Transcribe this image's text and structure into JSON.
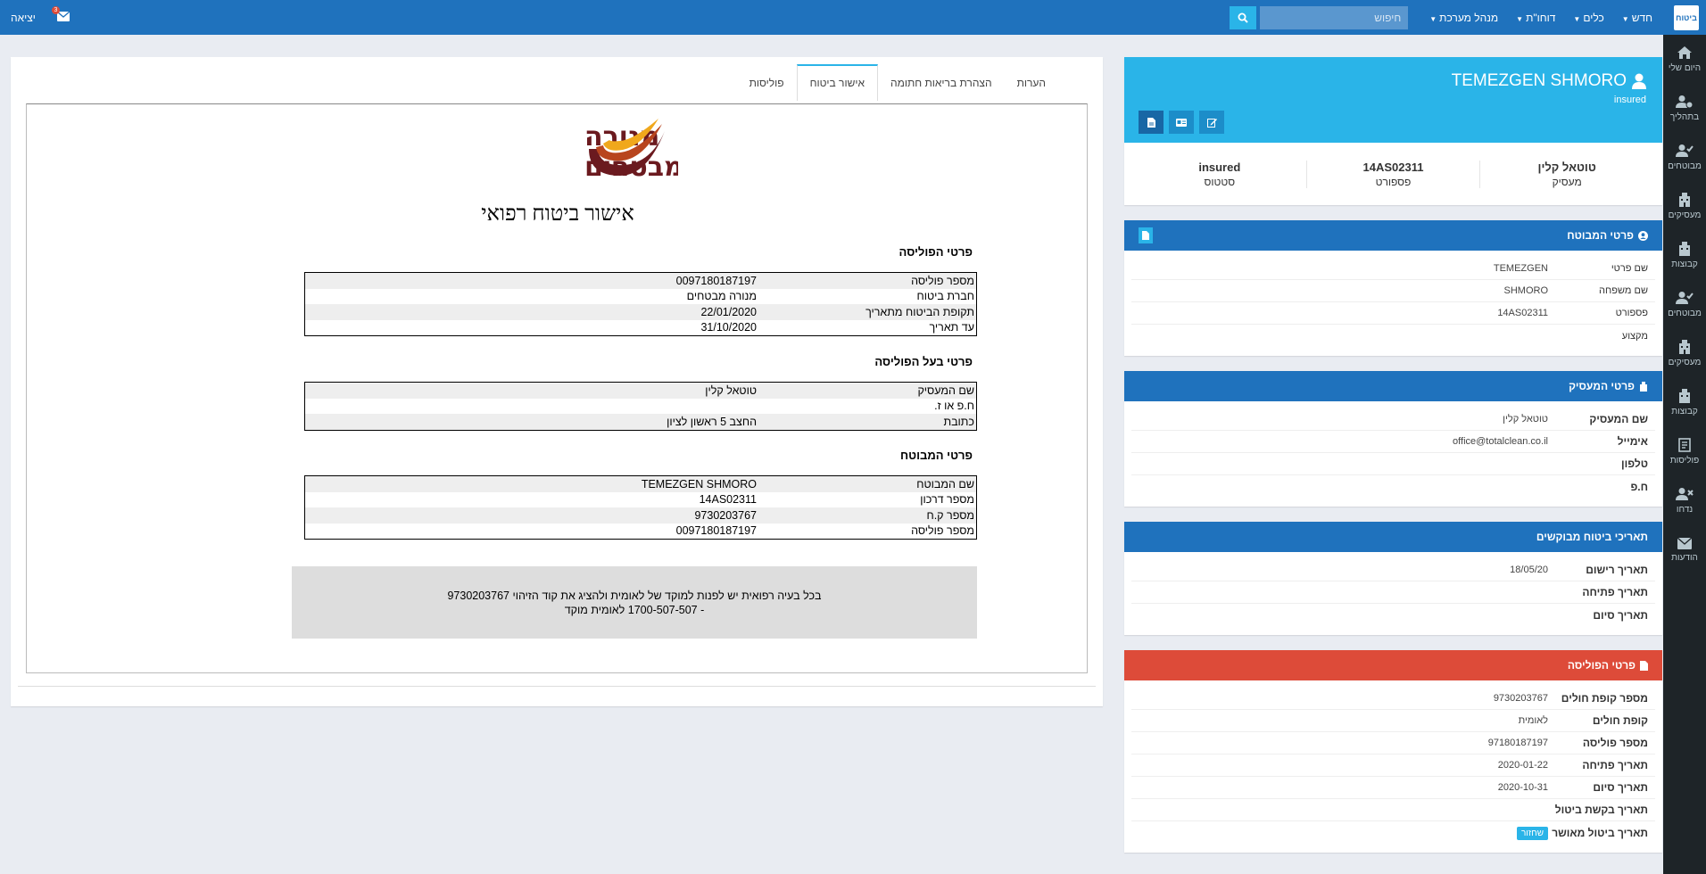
{
  "topbar": {
    "logo_text": "ביטוח",
    "menu": [
      {
        "label": "חדש",
        "caret": true
      },
      {
        "label": "כלים",
        "caret": true
      },
      {
        "label": "דוחו\"ת",
        "caret": true
      },
      {
        "label": "מנהל מערכת",
        "caret": true
      }
    ],
    "search_placeholder": "חיפוש",
    "exit_label": "יציאה",
    "mail_count": "3"
  },
  "sidebar": [
    {
      "label": "היום שלי",
      "icon": "home-icon"
    },
    {
      "label": "בתהליך",
      "icon": "user-clock-icon"
    },
    {
      "label": "מבוטחים",
      "icon": "user-check-icon"
    },
    {
      "label": "מעסיקים",
      "icon": "building-icon"
    },
    {
      "label": "קבוצות",
      "icon": "group-icon"
    },
    {
      "label": "מבוטחים",
      "icon": "user-check-icon"
    },
    {
      "label": "מעסיקים",
      "icon": "building-icon"
    },
    {
      "label": "קבוצות",
      "icon": "group-icon"
    },
    {
      "label": "פוליסות",
      "icon": "policy-icon"
    },
    {
      "label": "נדחו",
      "icon": "user-x-icon"
    },
    {
      "label": "הודעות",
      "icon": "envelope-icon"
    }
  ],
  "profile": {
    "name": "TEMEZGEN SHMORO",
    "role": "insured",
    "stats": [
      {
        "value": "טוטאל קלין",
        "label": "מעסיק"
      },
      {
        "value": "14AS02311",
        "label": "פספורט"
      },
      {
        "value": "insured",
        "label": "סטטוס"
      }
    ]
  },
  "insured_box": {
    "title": "פרטי המבוטח",
    "rows": [
      {
        "k": "שם פרטי",
        "v": "TEMEZGEN"
      },
      {
        "k": "שם משפחה",
        "v": "SHMORO"
      },
      {
        "k": "פספורט",
        "v": "14AS02311"
      },
      {
        "k": "מקצוע",
        "v": ""
      }
    ]
  },
  "employer_box": {
    "title": "פרטי המעסיק",
    "rows": [
      {
        "k": "שם המעסיק",
        "v": "טוטאל קלין"
      },
      {
        "k": "אימייל",
        "v": "office@totalclean.co.il"
      },
      {
        "k": "טלפון",
        "v": ""
      },
      {
        "k": "ח.פ",
        "v": ""
      }
    ]
  },
  "dates_box": {
    "title": "תאריכי ביטוח מבוקשים",
    "rows": [
      {
        "k": "תאריך רישום",
        "v": "18/05/20"
      },
      {
        "k": "תאריך פתיחה",
        "v": ""
      },
      {
        "k": "תאריך סיום",
        "v": ""
      }
    ]
  },
  "policy_box": {
    "title": "פרטי הפוליסה",
    "rows": [
      {
        "k": "מספר קופת חולים",
        "v": "9730203767"
      },
      {
        "k": "קופת חולים",
        "v": "לאומית"
      },
      {
        "k": "מספר פוליסה",
        "v": "97180187197"
      },
      {
        "k": "תאריך פתיחה",
        "v": "2020-01-22"
      },
      {
        "k": "תאריך סיום",
        "v": "2020-10-31"
      },
      {
        "k": "תאריך בקשת ביטול",
        "v": ""
      },
      {
        "k": "תאריך ביטול מאושר",
        "v": ""
      }
    ],
    "restore_label": "שחזור"
  },
  "tabs": [
    {
      "label": "הערות",
      "active": false
    },
    {
      "label": "הצהרת בריאות חתומה",
      "active": false
    },
    {
      "label": "אישור ביטוח",
      "active": true
    },
    {
      "label": "פוליסות",
      "active": false
    }
  ],
  "certificate": {
    "brand_line1": "מנורה",
    "brand_line2": "מבטחים",
    "title": "אישור ביטוח רפואי",
    "policy_section": "פרטי הפוליסה",
    "policy_rows": [
      {
        "k": "מספר פוליסה",
        "v": "0097180187197"
      },
      {
        "k": "חברת ביטוח",
        "v": "מנורה מבטחים"
      },
      {
        "k": "תקופת הביטוח מתאריך",
        "v": "22/01/2020"
      },
      {
        "k": "עד תאריך",
        "v": "31/10/2020"
      }
    ],
    "owner_section": "פרטי בעל הפוליסה",
    "owner_rows": [
      {
        "k": "שם המעסיק",
        "v": "טוטאל קלין"
      },
      {
        "k": "ח.פ או ז.",
        "v": ""
      },
      {
        "k": "כתובת",
        "v": "החצב 5 ראשון לציון"
      }
    ],
    "insured_section": "פרטי המבוטח",
    "insured_rows": [
      {
        "k": "שם המבוטח",
        "v": "TEMEZGEN SHMORO"
      },
      {
        "k": "מספר דרכון",
        "v": "14AS02311"
      },
      {
        "k": "מספר ק.ח",
        "v": "9730203767"
      },
      {
        "k": "מספר פוליסה",
        "v": "0097180187197"
      }
    ],
    "note_line1": "בכל בעיה רפואית יש לפנות למוקד של לאומית ולהציג את קוד הזיהוי 9730203767",
    "note_line2": "- 1700-507-507 לאומית מוקד"
  },
  "colors": {
    "topbar": "#1f72bd",
    "accent": "#2ab4e8",
    "danger": "#dd4b39",
    "sidebar": "#1e2428",
    "brand_dark": "#6b1a1f",
    "brand_gold": "#f0a81c"
  }
}
